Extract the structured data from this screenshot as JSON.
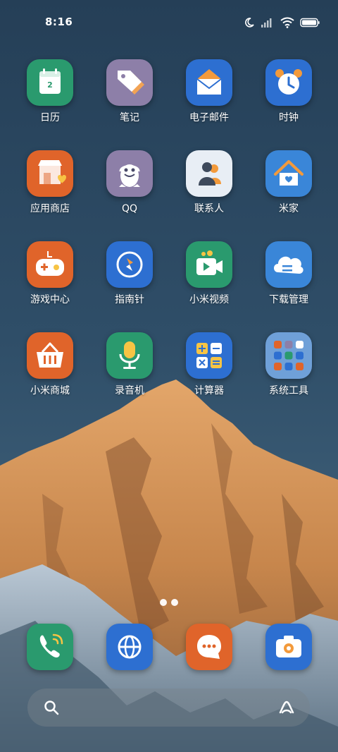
{
  "status_bar": {
    "time": "8:16"
  },
  "apps": [
    {
      "label": "日历",
      "icon": "calendar-icon",
      "day": "2",
      "bg": "#2a9a6e"
    },
    {
      "label": "笔记",
      "icon": "note-tag-icon",
      "bg": "#8d7fa8"
    },
    {
      "label": "电子邮件",
      "icon": "envelope-icon",
      "bg": "#2d6fd1"
    },
    {
      "label": "时钟",
      "icon": "alarm-clock-icon",
      "bg": "#2d6fd1"
    },
    {
      "label": "应用商店",
      "icon": "store-icon",
      "bg": "#e0642a"
    },
    {
      "label": "QQ",
      "icon": "penguin-icon",
      "bg": "#8d7fa8"
    },
    {
      "label": "联系人",
      "icon": "contacts-icon",
      "bg": "#e8eef5"
    },
    {
      "label": "米家",
      "icon": "home-icon",
      "bg": "#3a86d8"
    },
    {
      "label": "游戏中心",
      "icon": "gamepad-icon",
      "bg": "#e0642a"
    },
    {
      "label": "指南针",
      "icon": "compass-icon",
      "bg": "#2d6fd1"
    },
    {
      "label": "小米视频",
      "icon": "video-icon",
      "bg": "#2a9a6e"
    },
    {
      "label": "下载管理",
      "icon": "cloud-download-icon",
      "bg": "#3a86d8"
    },
    {
      "label": "小米商城",
      "icon": "basket-icon",
      "bg": "#e0642a"
    },
    {
      "label": "录音机",
      "icon": "microphone-icon",
      "bg": "#2a9a6e"
    },
    {
      "label": "计算器",
      "icon": "calculator-icon",
      "bg": "#2d6fd1"
    },
    {
      "label": "系统工具",
      "icon": "folder-icon",
      "bg": "#6fa0d8"
    }
  ],
  "dock": [
    {
      "icon": "phone-icon",
      "bg": "#2a9a6e"
    },
    {
      "icon": "browser-globe-icon",
      "bg": "#2d6fd1"
    },
    {
      "icon": "messages-icon",
      "bg": "#e0642a"
    },
    {
      "icon": "camera-icon",
      "bg": "#2d6fd1"
    }
  ],
  "search_bar": {
    "left_icon": "search-icon",
    "right_icon": "assistant-icon"
  },
  "page_indicator": {
    "pages": 2,
    "current": 1
  }
}
